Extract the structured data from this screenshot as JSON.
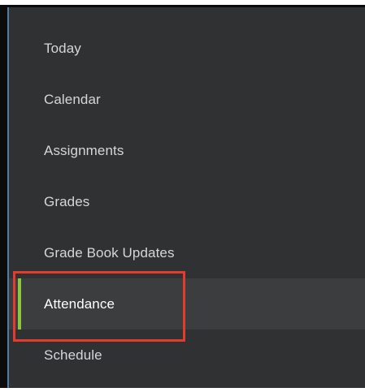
{
  "sidebar": {
    "items": [
      {
        "label": "Today",
        "active": false
      },
      {
        "label": "Calendar",
        "active": false
      },
      {
        "label": "Assignments",
        "active": false
      },
      {
        "label": "Grades",
        "active": false
      },
      {
        "label": "Grade Book Updates",
        "active": false
      },
      {
        "label": "Attendance",
        "active": true
      },
      {
        "label": "Schedule",
        "active": false
      }
    ]
  },
  "colors": {
    "sidebar_bg": "#303132",
    "active_bg": "#3c3d3e",
    "active_indicator": "#8cc63f",
    "highlight_border": "#e53b2c",
    "text": "#d6d6d6"
  }
}
